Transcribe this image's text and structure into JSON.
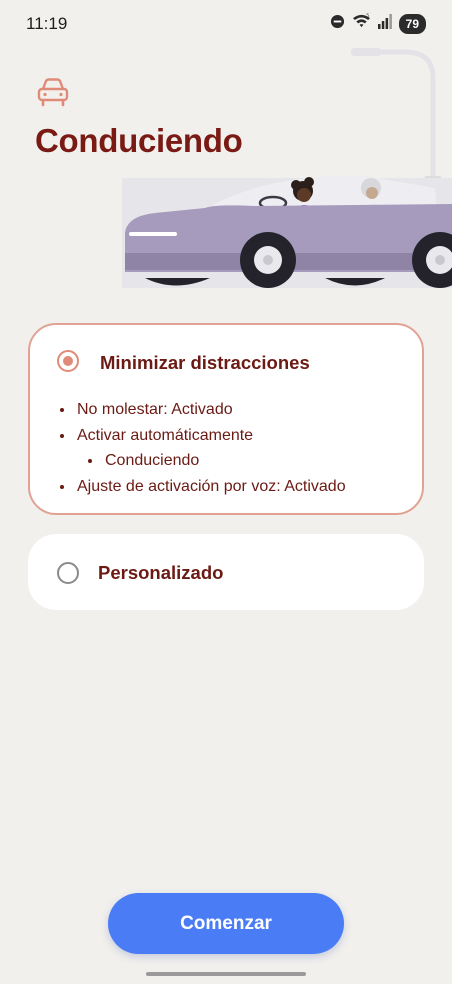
{
  "status_bar": {
    "time": "11:19",
    "battery": "79",
    "icons": [
      "do-not-disturb-icon",
      "wifi-icon",
      "signal-icon",
      "battery-icon"
    ]
  },
  "header": {
    "icon": "car-icon",
    "title": "Conduciendo"
  },
  "options": [
    {
      "title": "Minimizar distracciones",
      "selected": true,
      "items": [
        {
          "text": "No molestar: Activado",
          "level": 0
        },
        {
          "text": "Activar automáticamente",
          "level": 0
        },
        {
          "text": "Conduciendo",
          "level": 1
        },
        {
          "text": "Ajuste de activación por voz: Activado",
          "level": 0
        }
      ]
    },
    {
      "title": "Personalizado",
      "selected": false
    }
  ],
  "start_button": {
    "label": "Comenzar"
  },
  "colors": {
    "background": "#f2f0ed",
    "title": "#7a1a14",
    "accent_selected": "#e08b78",
    "card_border": "#e1a294",
    "button": "#4a7cf6",
    "car_body": "#a79bbd"
  }
}
